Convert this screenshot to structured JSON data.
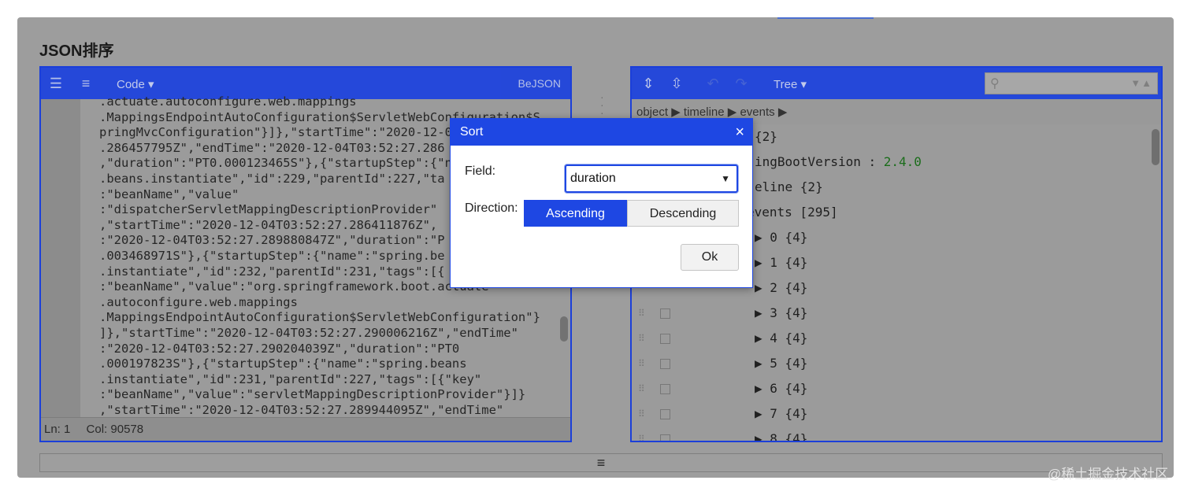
{
  "page": {
    "title": "JSON排序"
  },
  "left_panel": {
    "toolbar": {
      "mode_menu": "Code ▾",
      "brand": "BeJSON"
    },
    "code_lines": [
      ".actuate.autoconfigure.web.mappings",
      ".MappingsEndpointAutoConfiguration$ServletWebConfiguration$S",
      "pringMvcConfiguration\"}]},\"startTime\":\"2020-12-04T03:52:27",
      ".286457795Z\",\"endTime\":\"2020-12-04T03:52:27.286",
      ",\"duration\":\"PT0.000123465S\"},{\"startupStep\":{\"n",
      ".beans.instantiate\",\"id\":229,\"parentId\":227,\"ta",
      ":\"beanName\",\"value\"",
      ":\"dispatcherServletMappingDescriptionProvider\"",
      ",\"startTime\":\"2020-12-04T03:52:27.286411876Z\",",
      ":\"2020-12-04T03:52:27.289880847Z\",\"duration\":\"P",
      ".003468971S\"},{\"startupStep\":{\"name\":\"spring.be",
      ".instantiate\",\"id\":232,\"parentId\":231,\"tags\":[{",
      ":\"beanName\",\"value\":\"org.springframework.boot.actuate",
      ".autoconfigure.web.mappings",
      ".MappingsEndpointAutoConfiguration$ServletWebConfiguration\"}",
      "]},\"startTime\":\"2020-12-04T03:52:27.290006216Z\",\"endTime\"",
      ":\"2020-12-04T03:52:27.290204039Z\",\"duration\":\"PT0",
      ".000197823S\"},{\"startupStep\":{\"name\":\"spring.beans",
      ".instantiate\",\"id\":231,\"parentId\":227,\"tags\":[{\"key\"",
      ":\"beanName\",\"value\":\"servletMappingDescriptionProvider\"}]}",
      ",\"startTime\":\"2020-12-04T03:52:27.289944095Z\",\"endTime\""
    ],
    "status": {
      "line": "Ln: 1",
      "col": "Col: 90578"
    }
  },
  "right_panel": {
    "toolbar": {
      "mode_menu": "Tree ▾"
    },
    "search": {
      "placeholder": "",
      "arrows": "▼▲"
    },
    "breadcrumb": "object ▶ timeline ▶ events ▶",
    "tree_rows": [
      {
        "label": "{2}",
        "value": ""
      },
      {
        "label": "ingBootVersion : ",
        "value": "2.4.0"
      },
      {
        "label": "eline {2}",
        "value": ""
      },
      {
        "label": "events [295]",
        "value": ""
      },
      {
        "label": "▶ 0 {4}",
        "value": ""
      },
      {
        "label": "▶ 1 {4}",
        "value": ""
      },
      {
        "label": "▶ 2 {4}",
        "value": ""
      },
      {
        "label": "▶ 3 {4}",
        "value": ""
      },
      {
        "label": "▶ 4 {4}",
        "value": ""
      },
      {
        "label": "▶ 5 {4}",
        "value": ""
      },
      {
        "label": "▶ 6 {4}",
        "value": ""
      },
      {
        "label": "▶ 7 {4}",
        "value": ""
      },
      {
        "label": "▶ 8 {4}",
        "value": ""
      }
    ]
  },
  "bottom_bar": {
    "handle": "≡"
  },
  "dialog": {
    "title": "Sort",
    "close": "×",
    "field_label": "Field:",
    "field_value": "duration",
    "direction_label": "Direction:",
    "ascending": "Ascending",
    "descending": "Descending",
    "ok": "Ok"
  },
  "watermark": "@稀土掘金技术社区"
}
